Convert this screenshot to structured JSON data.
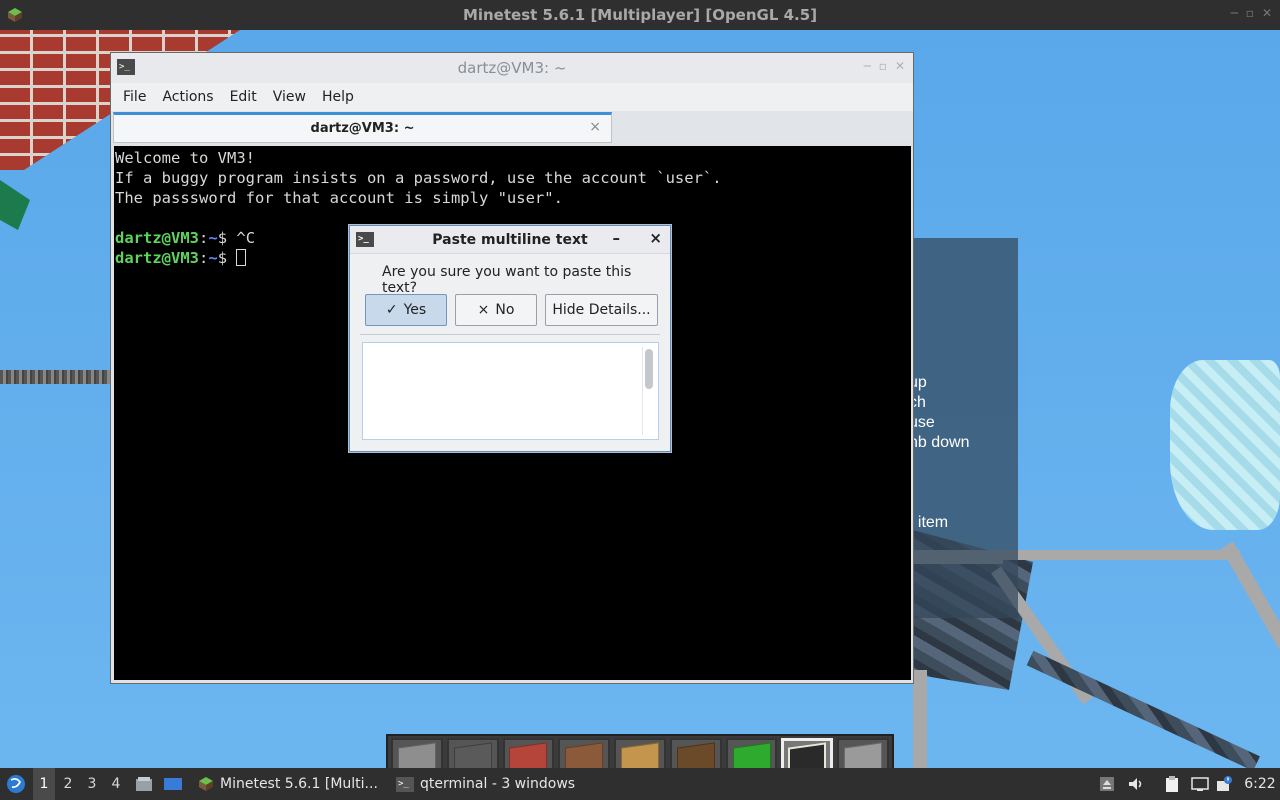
{
  "window_title": "Minetest 5.6.1 [Multiplayer] [OpenGL 4.5]",
  "minetest_menu_fragments": [
    "up",
    "ch",
    "use",
    "nb down",
    "t item"
  ],
  "terminal": {
    "title": "dartz@VM3: ~",
    "menu": [
      "File",
      "Actions",
      "Edit",
      "View",
      "Help"
    ],
    "tab_title": "dartz@VM3: ~",
    "tab_close": "×",
    "lines": [
      "Welcome to VM3!",
      "If a buggy program insists on a password, use the account `user`.",
      "The passsword for that account is simply \"user\"."
    ],
    "prompt_user": "dartz@VM3",
    "prompt_colon": ":",
    "prompt_path": "~",
    "prompt_dollar": "$ ",
    "cmd1": "^C"
  },
  "dialog": {
    "title": "Paste multiline text",
    "minimize": "–",
    "close": "×",
    "question": "Are you sure you want to paste this text?",
    "yes_icon": "✓",
    "yes": "Yes",
    "no_icon": "×",
    "no": "No",
    "hide_details": "Hide Details..."
  },
  "hotbar": {
    "selected_index": 7,
    "blocks": [
      {
        "name": "stone-block",
        "color": "#8e8e8e"
      },
      {
        "name": "cobble-block",
        "color": "#5a5a5a"
      },
      {
        "name": "brick-block",
        "color": "#b5443a"
      },
      {
        "name": "dirt-block",
        "color": "#8a5a3a"
      },
      {
        "name": "wood-planks-block",
        "color": "#c4954c"
      },
      {
        "name": "tree-block",
        "color": "#6b4a2a"
      },
      {
        "name": "leaves-block",
        "color": "#2eaa2e"
      },
      {
        "name": "glass-block",
        "color": "#2a2a2a"
      },
      {
        "name": "stone-slab-block",
        "color": "#9a9a9a"
      }
    ]
  },
  "taskbar": {
    "workspaces": [
      "1",
      "2",
      "3",
      "4"
    ],
    "task_minetest": "Minetest 5.6.1 [Multi...",
    "task_terminal": "qterminal - 3 windows",
    "clock": "6:22"
  }
}
